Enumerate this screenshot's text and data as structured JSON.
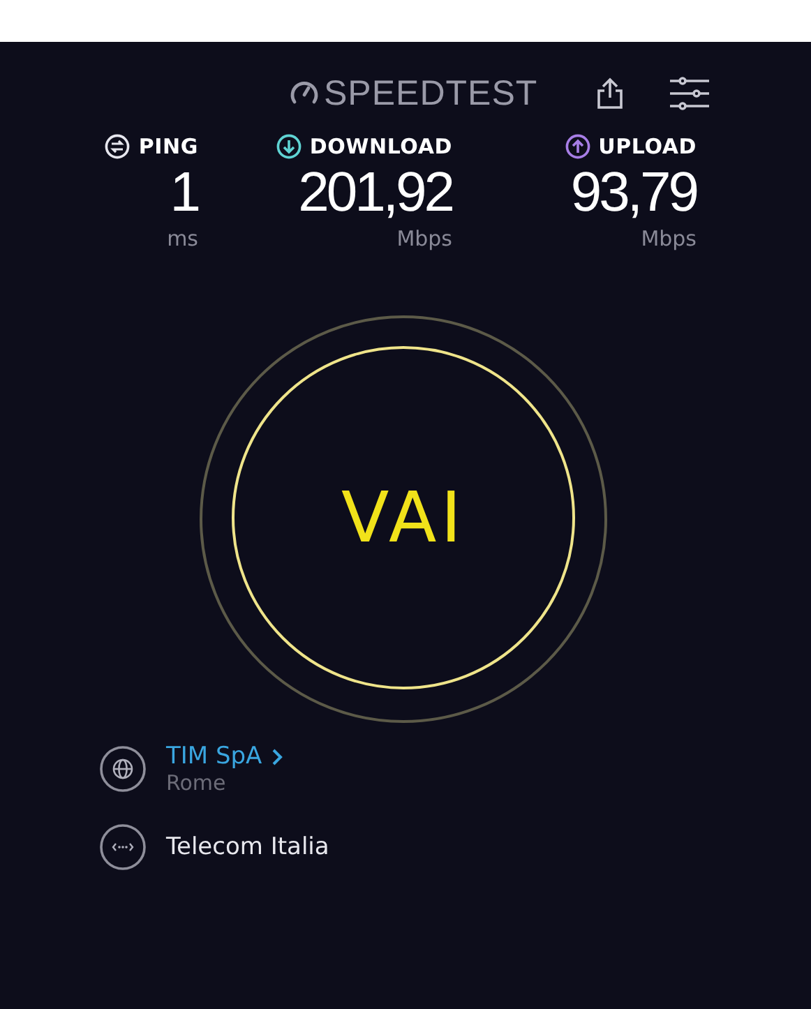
{
  "header": {
    "logo": "SPEEDTEST"
  },
  "metrics": [
    {
      "kind": "ping",
      "label": "PING",
      "value": "1",
      "unit": "ms",
      "color": "#e6e6ee"
    },
    {
      "kind": "download",
      "label": "DOWNLOAD",
      "value": "201,92",
      "unit": "Mbps",
      "color": "#5fd3d3"
    },
    {
      "kind": "upload",
      "label": "UPLOAD",
      "value": "93,79",
      "unit": "Mbps",
      "color": "#a77ee6"
    }
  ],
  "start_button": {
    "label": "VAI"
  },
  "server": {
    "name": "TIM SpA",
    "location": "Rome"
  },
  "provider": {
    "name": "Telecom Italia"
  }
}
